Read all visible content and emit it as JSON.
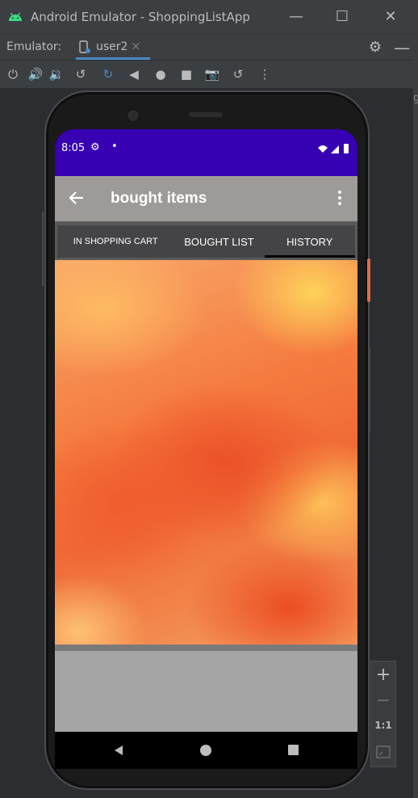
{
  "window": {
    "title": "Android Emulator - ShoppingListApp",
    "controls": [
      "minimize-icon",
      "maximize-icon",
      "close-icon"
    ]
  },
  "emulator_bar": {
    "label": "Emulator:",
    "device_tab": "user2",
    "close_glyph": "×"
  },
  "toolbar": {
    "icons": [
      "power-icon",
      "volume-up-icon",
      "volume-down-icon",
      "rotate-left-icon",
      "rotate-right-icon",
      "back-icon",
      "home-icon",
      "overview-icon",
      "screenshot-icon",
      "snapshot-icon",
      "more-icon"
    ]
  },
  "phone": {
    "status_bar": {
      "time": "8:05",
      "dot": "•",
      "color": "#3700b3"
    },
    "app_bar": {
      "title": "bought items",
      "color": "#9e9a98"
    },
    "tabs": [
      {
        "label": "IN SHOPPING CART",
        "active": false
      },
      {
        "label": "BOUGHT LIST",
        "active": false
      },
      {
        "label": "HISTORY",
        "active": true
      }
    ]
  },
  "zoom_controls": {
    "plus": "+",
    "minus": "−",
    "one_to_one": "1:1"
  },
  "peek_text": "g"
}
